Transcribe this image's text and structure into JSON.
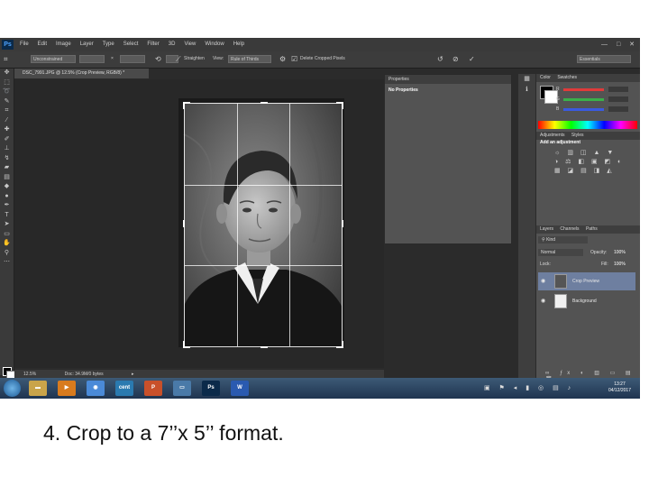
{
  "app": {
    "logo": "Ps",
    "menu": [
      "File",
      "Edit",
      "Image",
      "Layer",
      "Type",
      "Select",
      "Filter",
      "3D",
      "View",
      "Window",
      "Help"
    ],
    "window_controls": [
      "—",
      "□",
      "✕"
    ]
  },
  "options_bar": {
    "ratio_preset": "Unconstrained",
    "swap_symbol": "×",
    "straighten": "Straighten",
    "view_label": "View:",
    "view_value": "Rule of Thirds",
    "delete_cropped": "Delete Cropped Pixels",
    "workspace": "Essentials"
  },
  "document": {
    "tab_title": "DSC_7991.JPG @ 12.5% (Crop Preview, RGB/8) *",
    "zoom": "12.5%",
    "doc_info": "Doc: 34.9M/0 bytes"
  },
  "properties": {
    "title": "Properties",
    "subtitle": "No Properties"
  },
  "color_panel": {
    "tabs": [
      "Color",
      "Swatches"
    ],
    "channels": [
      {
        "label": "R",
        "color": "#e03a3a"
      },
      {
        "label": "G",
        "color": "#3ab04a"
      },
      {
        "label": "B",
        "color": "#3a5ae0"
      }
    ]
  },
  "adjustments": {
    "tabs": [
      "Adjustments",
      "Styles"
    ],
    "title": "Add an adjustment",
    "icons": "☼ ▥ ◫ ▲ ▼ ◑ ⚖ ◧ ▣ ◩ ◐ ▦ ◪ ▤ ◨ ◭"
  },
  "layers": {
    "tabs": [
      "Layers",
      "Channels",
      "Paths"
    ],
    "kind": "Kind",
    "blend_mode": "Normal",
    "opacity_label": "Opacity:",
    "opacity_value": "100%",
    "lock_label": "Lock:",
    "fill_label": "Fill:",
    "fill_value": "100%",
    "items": [
      {
        "name": "Crop Preview",
        "selected": true
      },
      {
        "name": "Background",
        "selected": false
      }
    ]
  },
  "taskbar": {
    "apps": [
      {
        "icon": "folder-icon",
        "glyph": "▬",
        "color": "#c9a44a"
      },
      {
        "icon": "media-player-icon",
        "glyph": "▶",
        "color": "#d87b1e"
      },
      {
        "icon": "chrome-icon",
        "glyph": "◉",
        "color": "#4a8ad8"
      },
      {
        "icon": "app-icon",
        "glyph": "cent",
        "color": "#2a7ab0"
      },
      {
        "icon": "powerpoint-icon",
        "glyph": "P",
        "color": "#c8502a"
      },
      {
        "icon": "display-icon",
        "glyph": "▭",
        "color": "#4a7aa8"
      },
      {
        "icon": "photoshop-icon",
        "glyph": "Ps",
        "color": "#0b2a4a"
      },
      {
        "icon": "word-icon",
        "glyph": "W",
        "color": "#2a5ab0"
      }
    ],
    "time": "13:27",
    "date": "04/12/2017"
  },
  "caption": "4. Crop to a 7’’x 5’’ format."
}
